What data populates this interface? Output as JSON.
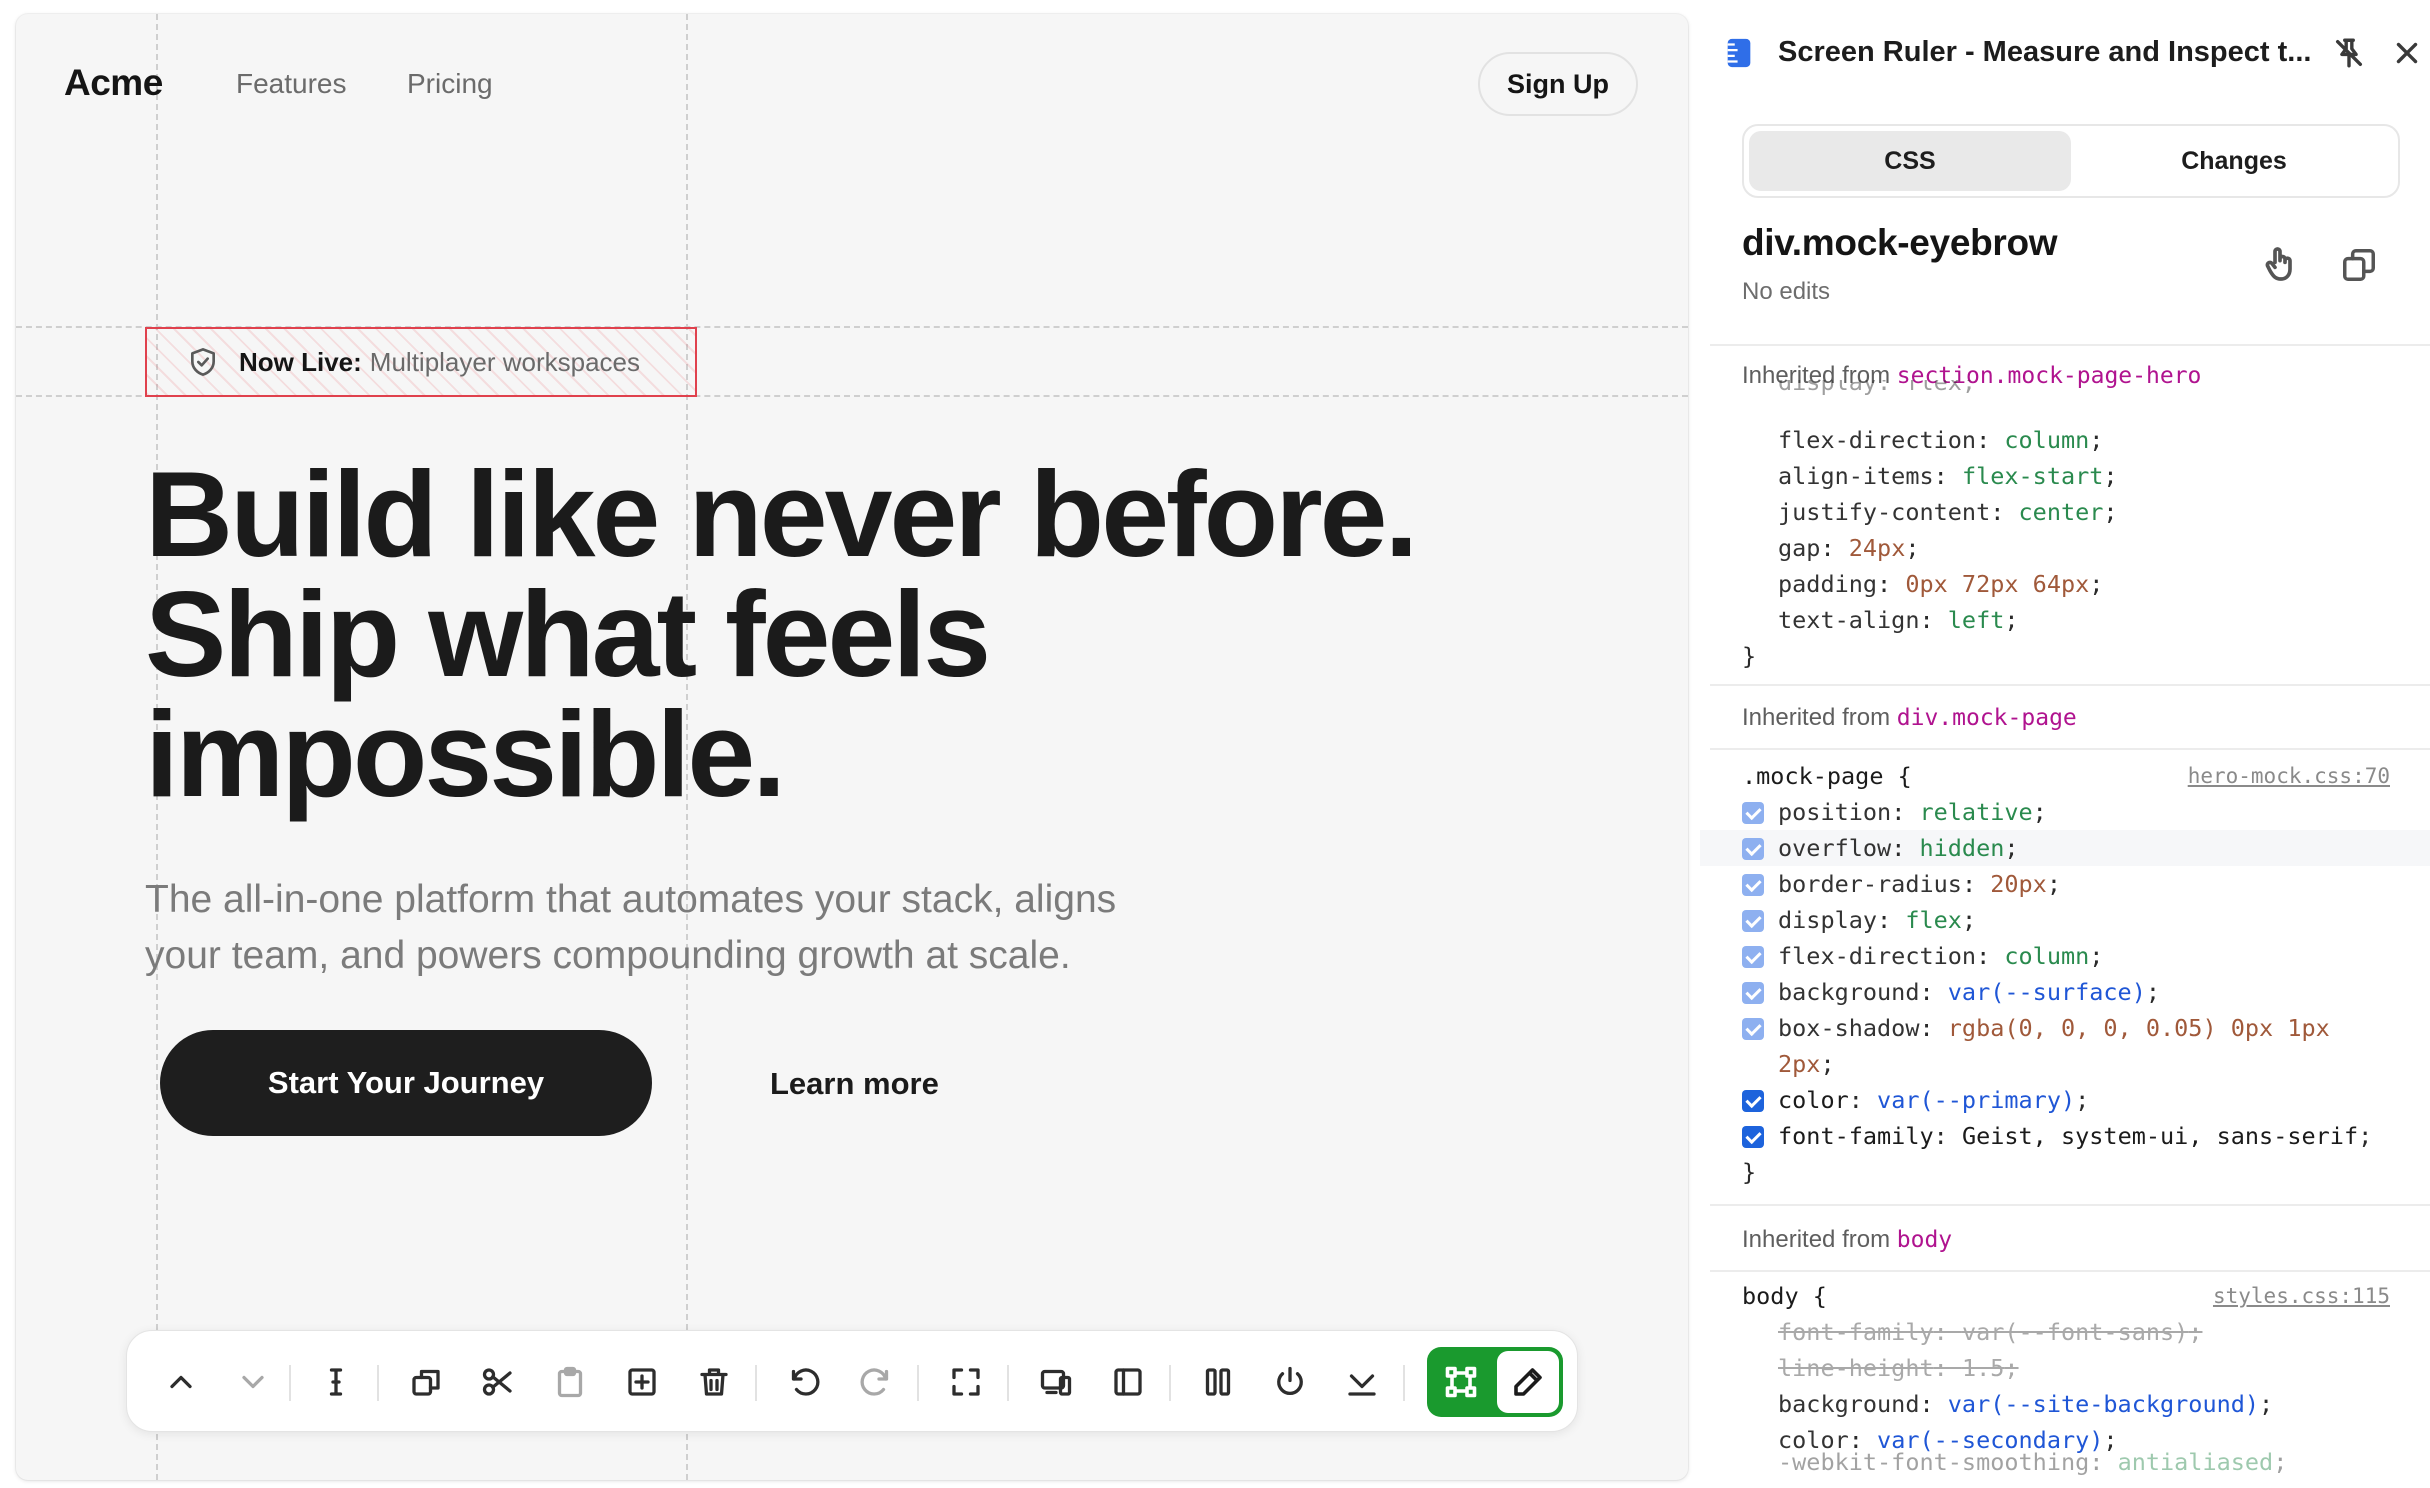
{
  "mock_page": {
    "nav": {
      "brand": "Acme",
      "links": [
        "Features",
        "Pricing"
      ],
      "signup_label": "Sign Up"
    },
    "eyebrow": {
      "bold": "Now Live:",
      "text": "Multiplayer workspaces",
      "icon": "shield-check-icon"
    },
    "hero_title": [
      "Build like never before.",
      "Ship what feels",
      "impossible."
    ],
    "hero_subtitle": [
      "The all-in-one platform that automates your stack, aligns",
      "your team, and powers compounding growth at scale."
    ],
    "cta_primary": "Start Your Journey",
    "cta_secondary": "Learn more",
    "highlight_color": "#e0414d"
  },
  "toolbar": {
    "buttons": [
      "chevron-up-icon",
      "chevron-down-icon",
      "text-cursor-icon",
      "duplicate-icon",
      "scissors-icon",
      "clipboard-icon",
      "add-box-icon",
      "trash-icon",
      "undo-icon",
      "redo-icon",
      "fullscreen-icon",
      "responsive-icon",
      "sidebar-icon",
      "columns-icon",
      "power-icon",
      "download-icon"
    ],
    "toggle": [
      "select-frame-icon",
      "pencil-icon"
    ],
    "toggle_color": "#1a9a2e"
  },
  "panel": {
    "title": "Screen Ruler - Measure and Inspect t...",
    "tabs": [
      "CSS",
      "Changes"
    ],
    "active_tab": "CSS",
    "selected_element": "div.mock-eyebrow",
    "status": "No edits",
    "sections": {
      "hero": {
        "label": "Inherited from",
        "selector": "section.mock-page-hero",
        "cut_line": "display: flex;",
        "rules": [
          {
            "prop": "flex-direction",
            "value": "column"
          },
          {
            "prop": "align-items",
            "value": "flex-start"
          },
          {
            "prop": "justify-content",
            "value": "center"
          },
          {
            "prop": "gap",
            "value": "24px"
          },
          {
            "prop": "padding",
            "value": "0px 72px 64px"
          },
          {
            "prop": "text-align",
            "value": "left"
          }
        ]
      },
      "page": {
        "label": "Inherited from",
        "selector": "div.mock-page",
        "rule_selector": ".mock-page",
        "source": "hero-mock.css:70",
        "rules": [
          {
            "prop": "position",
            "value": "relative"
          },
          {
            "prop": "overflow",
            "value": "hidden"
          },
          {
            "prop": "border-radius",
            "value": "20px"
          },
          {
            "prop": "display",
            "value": "flex"
          },
          {
            "prop": "flex-direction",
            "value": "column"
          },
          {
            "prop": "background",
            "value": "var(--surface)"
          },
          {
            "prop": "box-shadow",
            "value": "rgba(0, 0, 0, 0.05) 0px 1px 2px"
          },
          {
            "prop": "color",
            "value": "var(--primary)"
          },
          {
            "prop": "font-family",
            "value": "Geist, system-ui, sans-serif"
          }
        ]
      },
      "body": {
        "label": "Inherited from",
        "selector": "body",
        "rule_selector": "body",
        "source": "styles.css:115",
        "rules": [
          {
            "prop": "font-family",
            "value": "var(--font-sans)",
            "overridden": true
          },
          {
            "prop": "line-height",
            "value": "1.5",
            "overridden": true
          },
          {
            "prop": "background",
            "value": "var(--site-background)"
          },
          {
            "prop": "color",
            "value": "var(--secondary)"
          },
          {
            "prop": "-webkit-font-smoothing",
            "value": "antialiased"
          }
        ]
      }
    }
  }
}
